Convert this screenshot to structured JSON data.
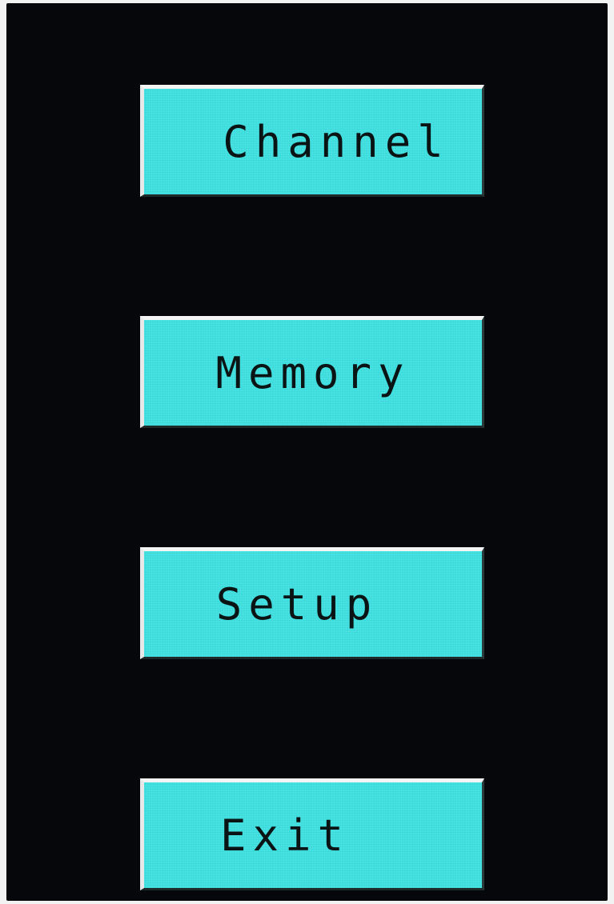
{
  "menu": {
    "items": [
      {
        "label": "Channel"
      },
      {
        "label": "Memory"
      },
      {
        "label": "Setup"
      },
      {
        "label": "Exit"
      }
    ]
  },
  "colors": {
    "screen_background": "#05070a",
    "button_background": "#40e0e0",
    "button_text": "#0a1414"
  }
}
